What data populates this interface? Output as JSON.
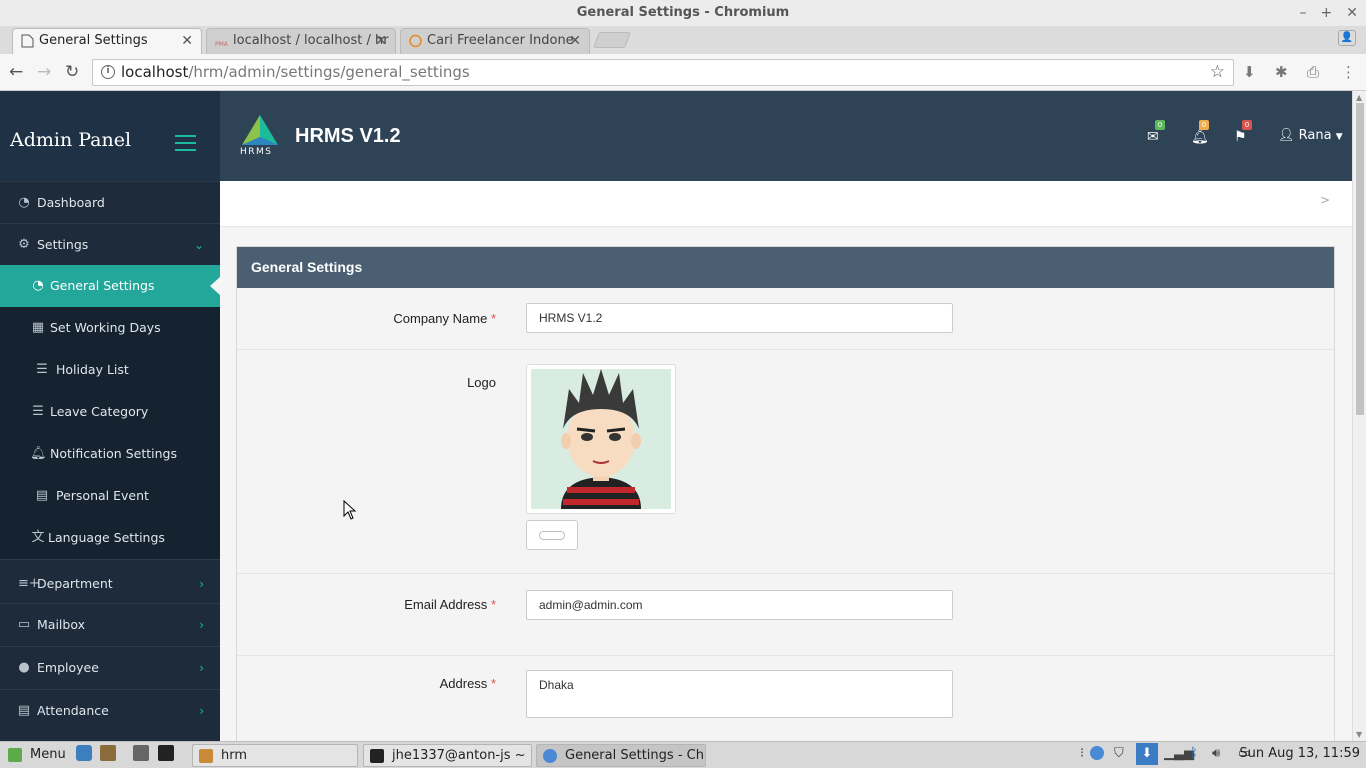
{
  "window": {
    "title": "General Settings - Chromium"
  },
  "tabs": [
    {
      "label": "General Settings",
      "active": true
    },
    {
      "label": "localhost / localhost / hr",
      "active": false
    },
    {
      "label": "Cari Freelancer Indone",
      "active": false
    }
  ],
  "address": {
    "host": "localhost",
    "path": "/hrm/admin/settings/general_settings"
  },
  "sidebar": {
    "brand": "Admin Panel",
    "items": [
      {
        "label": "Dashboard",
        "icon": "dashboard-icon"
      },
      {
        "label": "Settings",
        "icon": "gears-icon"
      }
    ],
    "settings_sub": [
      {
        "label": "General Settings",
        "icon": "dashboard-icon",
        "active": true
      },
      {
        "label": "Set Working Days",
        "icon": "calendar-icon"
      },
      {
        "label": "Holiday List",
        "icon": "list-icon"
      },
      {
        "label": "Leave Category",
        "icon": "indent-icon"
      },
      {
        "label": "Notification Settings",
        "icon": "bell-icon"
      },
      {
        "label": "Personal Event",
        "icon": "document-icon"
      },
      {
        "label": "Language Settings",
        "icon": "language-icon"
      }
    ],
    "more": [
      {
        "label": "Department",
        "icon": "list-plus-icon"
      },
      {
        "label": "Mailbox",
        "icon": "credit-card-icon"
      },
      {
        "label": "Employee",
        "icon": "user-icon"
      },
      {
        "label": "Attendance",
        "icon": "file-icon"
      }
    ]
  },
  "topnav": {
    "logo_text": "HRMS",
    "app_title": "HRMS V1.2",
    "mail_badge": "0",
    "bell_badge": "0",
    "flag_badge": "0",
    "user": "Rana",
    "colors": {
      "mail": "#5cb85c",
      "bell": "#f0ad4e",
      "flag": "#d9534f"
    }
  },
  "breadcrumb": ">",
  "panel": {
    "title": "General Settings",
    "company_label": "Company Name",
    "company_value": "HRMS V1.2",
    "logo_label": "Logo",
    "email_label": "Email Address",
    "email_value": "admin@admin.com",
    "address_label": "Address",
    "address_value": "Dhaka",
    "required_mark": "*"
  },
  "taskbar": {
    "menu": "Menu",
    "windows": [
      {
        "label": "hrm"
      },
      {
        "label": "jhe1337@anton-js ~"
      },
      {
        "label": "General Settings - Chr..."
      }
    ],
    "clock": "Sun Aug 13, 11:59"
  }
}
